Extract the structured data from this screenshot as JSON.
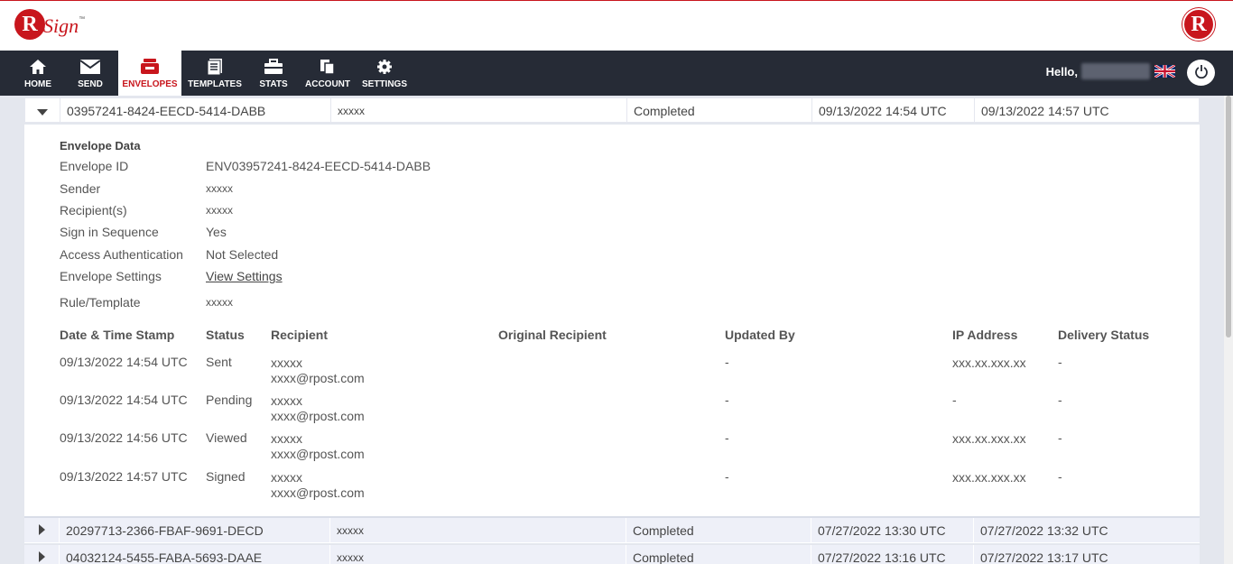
{
  "brand": {
    "logo_letter": "R",
    "logo_word": "Sign",
    "logo_tm": "™",
    "corner_letter": "R"
  },
  "nav": {
    "items": [
      {
        "label": "HOME",
        "icon": "home-icon"
      },
      {
        "label": "SEND",
        "icon": "envelope-icon"
      },
      {
        "label": "ENVELOPES",
        "icon": "inbox-icon",
        "active": true
      },
      {
        "label": "TEMPLATES",
        "icon": "document-icon"
      },
      {
        "label": "STATS",
        "icon": "briefcase-icon"
      },
      {
        "label": "ACCOUNT",
        "icon": "copy-icon"
      },
      {
        "label": "SETTINGS",
        "icon": "gear-icon"
      }
    ],
    "greeting": "Hello,",
    "language_icon": "uk-flag-icon",
    "logout_icon": "power-icon"
  },
  "envelopes": [
    {
      "id": "03957241-8424-EECD-5414-DABB",
      "subject": "xxxxx",
      "status": "Completed",
      "sent": "09/13/2022 14:54 UTC",
      "updated": "09/13/2022 14:57 UTC",
      "expanded": true
    },
    {
      "id": "20297713-2366-FBAF-9691-DECD",
      "subject": "xxxxx",
      "status": "Completed",
      "sent": "07/27/2022 13:30 UTC",
      "updated": "07/27/2022 13:32 UTC",
      "expanded": false
    },
    {
      "id": "04032124-5455-FABA-5693-DAAE",
      "subject": "xxxxx",
      "status": "Completed",
      "sent": "07/27/2022 13:16 UTC",
      "updated": "07/27/2022 13:17 UTC",
      "expanded": false
    }
  ],
  "detail": {
    "section_title": "Envelope Data",
    "fields": [
      {
        "label": "Envelope ID",
        "value": "ENV03957241-8424-EECD-5414-DABB"
      },
      {
        "label": "Sender",
        "value": "xxxxx"
      },
      {
        "label": "Recipient(s)",
        "value": "xxxxx"
      },
      {
        "label": "Sign in Sequence",
        "value": "Yes"
      },
      {
        "label": "Access Authentication",
        "value": "Not Selected"
      },
      {
        "label": "Envelope Settings",
        "value": "View Settings"
      },
      {
        "label": "Rule/Template",
        "value": "xxxxx"
      }
    ],
    "history_headers": [
      "Date & Time Stamp",
      "Status",
      "Recipient",
      "Original Recipient",
      "Updated By",
      "IP Address",
      "Delivery Status"
    ],
    "history": [
      {
        "timestamp": "09/13/2022 14:54 UTC",
        "status": "Sent",
        "recipient_name": "xxxxx",
        "recipient_email": "xxxx@rpost.com",
        "original_recipient": "",
        "updated_by": "-",
        "ip": "xxx.xx.xxx.xx",
        "delivery": "-"
      },
      {
        "timestamp": "09/13/2022 14:54 UTC",
        "status": "Pending",
        "recipient_name": "xxxxx",
        "recipient_email": "xxxx@rpost.com",
        "original_recipient": "",
        "updated_by": "-",
        "ip": "-",
        "delivery": "-"
      },
      {
        "timestamp": "09/13/2022 14:56 UTC",
        "status": "Viewed",
        "recipient_name": "xxxxx",
        "recipient_email": "xxxx@rpost.com",
        "original_recipient": "",
        "updated_by": "-",
        "ip": "xxx.xx.xxx.xx",
        "delivery": "-"
      },
      {
        "timestamp": "09/13/2022 14:57 UTC",
        "status": "Signed",
        "recipient_name": "xxxxx",
        "recipient_email": "xxxx@rpost.com",
        "original_recipient": "",
        "updated_by": "-",
        "ip": "xxx.xx.xxx.xx",
        "delivery": "-"
      }
    ]
  },
  "colors": {
    "accent": "#c8161d",
    "nav_bg": "#262b36",
    "row_bg": "#eef0f8"
  }
}
